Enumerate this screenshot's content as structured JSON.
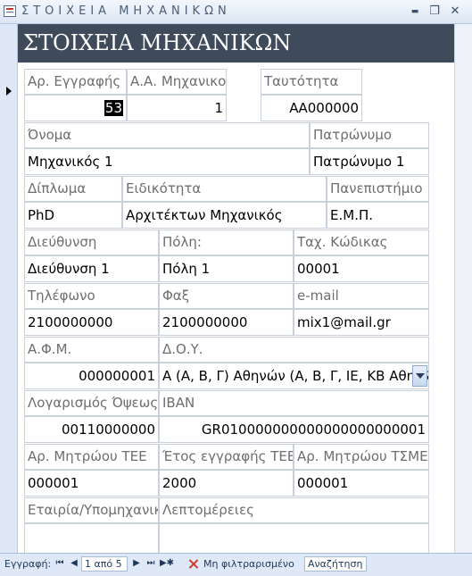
{
  "window": {
    "title": "ΣΤΟΙΧΕΙΑ ΜΗΧΑΝΙΚΩΝ",
    "minimize": "▬",
    "restore": "❐",
    "close": "✕"
  },
  "form": {
    "header_title": "ΣΤΟΙΧΕΙΑ ΜΗΧΑΝΙΚΩΝ",
    "labels": {
      "reg_no": "Αρ. Εγγραφής",
      "eng_id": "Α.Α. Μηχανικού",
      "id_card": "Ταυτότητα",
      "name": "Όνομα",
      "father_name": "Πατρώνυμο",
      "degree": "Δίπλωμα",
      "specialty": "Ειδικότητα",
      "university": "Πανεπιστήμιο",
      "address": "Διεύθυνση",
      "city": "Πόλη:",
      "zip": "Ταχ. Κώδικας",
      "phone": "Τηλέφωνο",
      "fax": "Φαξ",
      "email": "e-mail",
      "vat": "Α.Φ.Μ.",
      "tax_office": "Δ.Ο.Υ.",
      "account": "Λογαρισμός Όψεως",
      "iban": "IBAN",
      "tee_no": "Αρ. Μητρώου ΤΕΕ",
      "tee_year": "Έτος εγγραφής ΤΕΕ",
      "tsmede_no": "Αρ. Μητρώου ΤΣΜΕΔΕ",
      "company": "Εταιρία/Υπομηχανικός",
      "details": "Λεπτομέρειες"
    },
    "values": {
      "reg_no": "53",
      "eng_id": "1",
      "id_card": "ΑΑ000000",
      "name": "Μηχανικός 1",
      "father_name": "Πατρώνυμο 1",
      "degree": "PhD",
      "specialty": "Αρχιτέκτων Μηχανικός",
      "university": "Ε.Μ.Π.",
      "address": "Διεύθυνση 1",
      "city": "Πόλη 1",
      "zip": "00001",
      "phone": "2100000000",
      "fax": "2100000000",
      "email": "mix1@mail.gr",
      "vat": "000000001",
      "tax_office": "Α (Α, Β, Γ) Αθηνών (Α, Β, Γ, ΙΕ, ΚΒ Αθηνών)",
      "account": "00110000000",
      "iban": "GR010000000000000000000001",
      "tee_no": "000001",
      "tee_year": "2000",
      "tsmede_no": "000001",
      "company": "",
      "details": ""
    }
  },
  "navigation": {
    "record_label": "Εγγραφή:",
    "first": "⏮",
    "prev": "◀",
    "position": "1 από 5",
    "next": "▶",
    "last": "⏭",
    "new": "▶✱",
    "filter": "Μη φιλτραρισμένο",
    "search": "Αναζήτηση"
  }
}
